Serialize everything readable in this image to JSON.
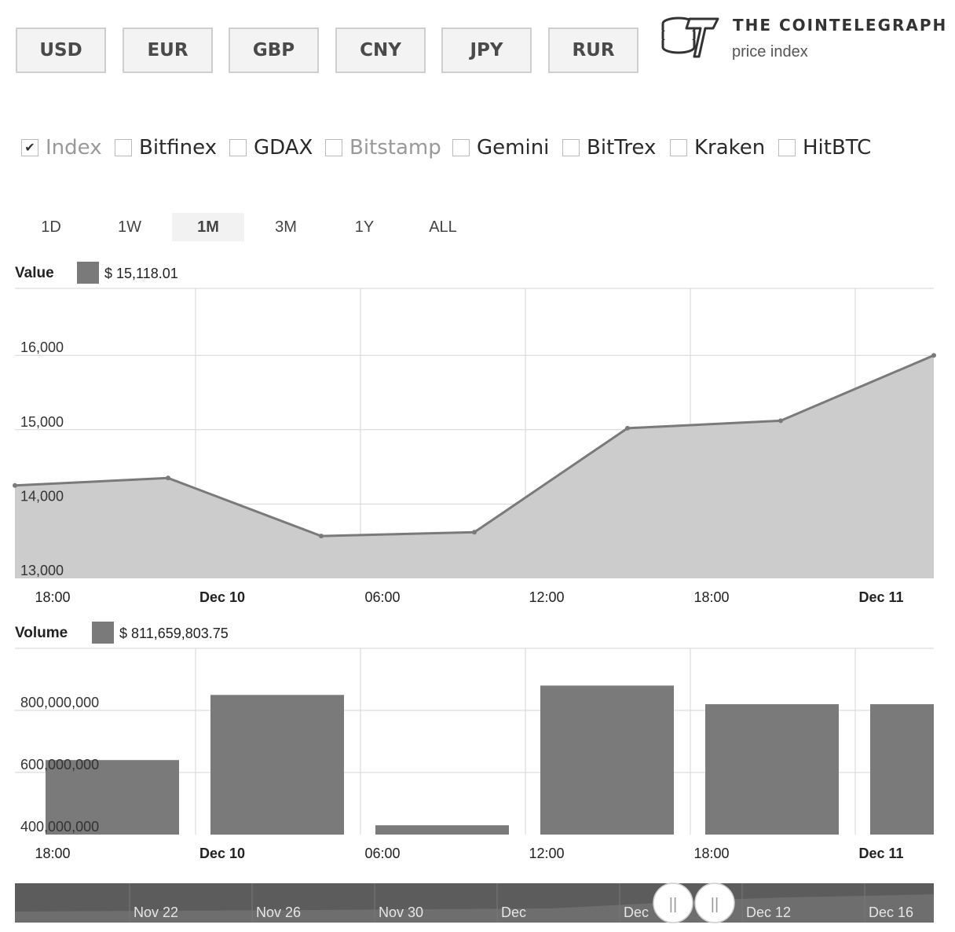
{
  "currencies": [
    "USD",
    "EUR",
    "GBP",
    "CNY",
    "JPY",
    "RUR"
  ],
  "logo": {
    "icon": "coin-stack-lightning-icon",
    "title": "THE COINTELEGRAPH",
    "subtitle": "price index"
  },
  "exchanges": [
    {
      "label": "Index",
      "checked": true,
      "muted": true
    },
    {
      "label": "Bitfinex",
      "checked": false,
      "muted": false
    },
    {
      "label": "GDAX",
      "checked": false,
      "muted": false
    },
    {
      "label": "Bitstamp",
      "checked": false,
      "muted": true
    },
    {
      "label": "Gemini",
      "checked": false,
      "muted": false
    },
    {
      "label": "BitTrex",
      "checked": false,
      "muted": false
    },
    {
      "label": "Kraken",
      "checked": false,
      "muted": false
    },
    {
      "label": "HitBTC",
      "checked": false,
      "muted": false
    }
  ],
  "ranges": {
    "items": [
      "1D",
      "1W",
      "1M",
      "3M",
      "1Y",
      "ALL"
    ],
    "active": "1M"
  },
  "value_header": {
    "label": "Value",
    "readout": "$ 15,118.01"
  },
  "volume_header": {
    "label": "Volume",
    "readout": "$ 811,659,803.75"
  },
  "chart_data": [
    {
      "type": "area",
      "title": "Value",
      "x_labels": [
        {
          "text": "18:00",
          "bold": false
        },
        {
          "text": "Dec 10",
          "bold": true
        },
        {
          "text": "06:00",
          "bold": false
        },
        {
          "text": "12:00",
          "bold": false
        },
        {
          "text": "18:00",
          "bold": false
        },
        {
          "text": "Dec 11",
          "bold": true
        }
      ],
      "x": [
        "Dec 9 15:00",
        "Dec 9 20:00",
        "Dec 10 02:00",
        "Dec 10 08:00",
        "Dec 10 14:00",
        "Dec 10 20:00",
        "Dec 11 02:00"
      ],
      "values": [
        14250,
        14350,
        13570,
        13620,
        15020,
        15120,
        16000
      ],
      "ylim": [
        13000,
        16900
      ],
      "y_ticks": [
        "13,000",
        "14,000",
        "15,000",
        "16,000"
      ],
      "grid": true,
      "fill_color": "#cccccc",
      "line_color": "#7a7a7a"
    },
    {
      "type": "bar",
      "title": "Volume",
      "x_labels": [
        {
          "text": "18:00",
          "bold": false
        },
        {
          "text": "Dec 10",
          "bold": true
        },
        {
          "text": "06:00",
          "bold": false
        },
        {
          "text": "12:00",
          "bold": false
        },
        {
          "text": "18:00",
          "bold": false
        },
        {
          "text": "Dec 11",
          "bold": true
        }
      ],
      "x": [
        "Dec 9 18:00",
        "Dec 10 00:00",
        "Dec 10 06:00",
        "Dec 10 12:00",
        "Dec 10 18:00",
        "Dec 11 00:00"
      ],
      "values": [
        640000000,
        850000000,
        430000000,
        880000000,
        820000000,
        820000000
      ],
      "ylim": [
        400000000,
        1000000000
      ],
      "y_ticks": [
        "400,000,000",
        "600,000,000",
        "800,000,000"
      ],
      "grid": true,
      "bar_color": "#7a7a7a"
    }
  ],
  "navigator": {
    "labels": [
      "Nov 22",
      "Nov 26",
      "Nov 30",
      "Dec",
      "Dec",
      "Dec 12",
      "Dec 16"
    ],
    "handle_icon": "grip-handle-icon",
    "handle_glyph": "||"
  }
}
